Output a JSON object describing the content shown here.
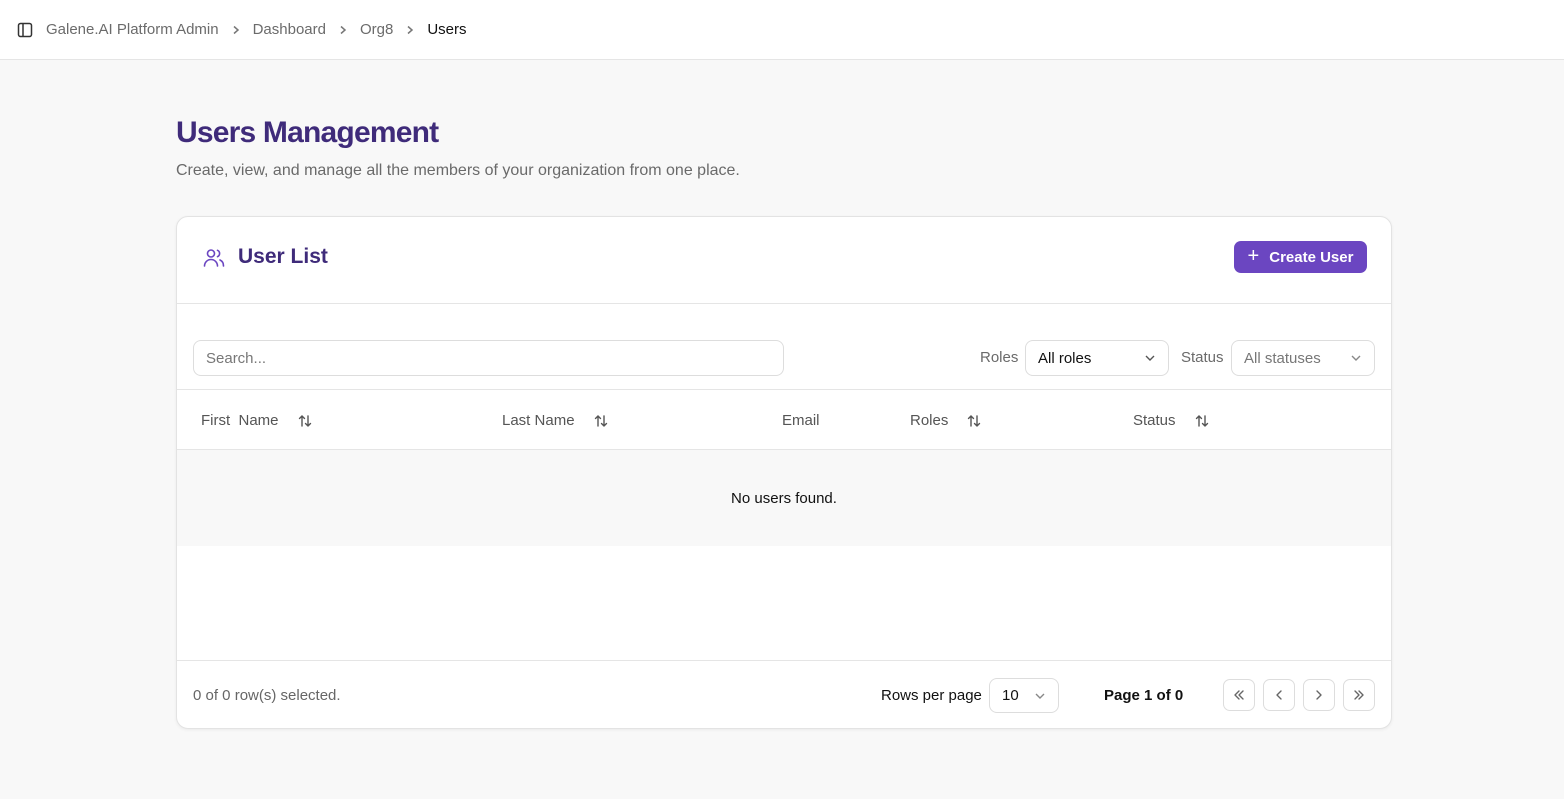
{
  "breadcrumb": {
    "items": [
      "Galene.AI Platform Admin",
      "Dashboard",
      "Org8",
      "Users"
    ]
  },
  "page": {
    "title": "Users Management",
    "subtitle": "Create, view, and manage all the members of your organization from one place."
  },
  "card": {
    "title": "User List",
    "create_label": "Create User"
  },
  "filters": {
    "search_placeholder": "Search...",
    "roles_label": "Roles",
    "roles_value": "All roles",
    "status_label": "Status",
    "status_value": "All statuses"
  },
  "table": {
    "columns": [
      "First  Name",
      "Last Name",
      "Email",
      "Roles",
      "Status"
    ],
    "empty_text": "No users found."
  },
  "footer": {
    "selected_text": "0 of 0 row(s) selected.",
    "rows_per_page_label": "Rows per page",
    "rows_per_page_value": "10",
    "page_info": "Page 1 of 0"
  },
  "colors": {
    "accent": "#6b46c1",
    "title": "#3f2b7a"
  }
}
